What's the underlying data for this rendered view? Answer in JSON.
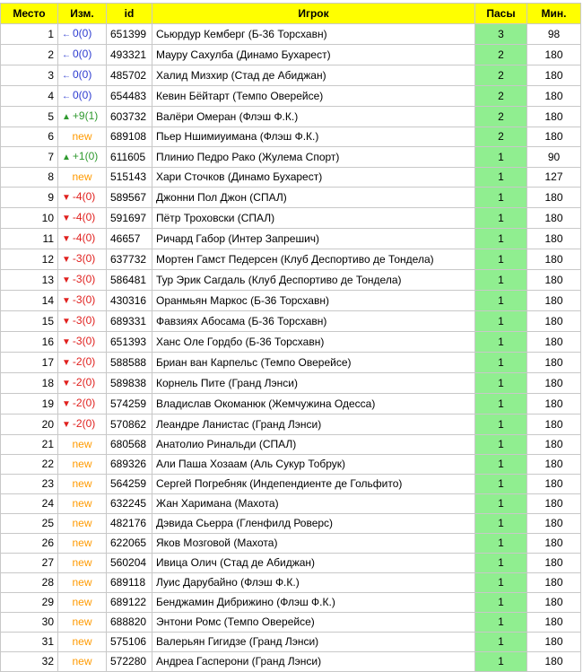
{
  "headers": {
    "place": "Место",
    "change": "Изм.",
    "id": "id",
    "player": "Игрок",
    "passes": "Пасы",
    "minutes": "Мин."
  },
  "colors": {
    "header_bg": "#ffff00",
    "passes_bg": "#90ee90",
    "flat": "#2c3bd0",
    "up": "#2f9a2f",
    "down": "#e0201e",
    "new": "#ff9a00"
  },
  "rows": [
    {
      "place": "1",
      "change_type": "flat",
      "change": "0(0)",
      "id": "651399",
      "player": "Сьюрдур Кемберг (Б-36 Торсхавн)",
      "passes": "3",
      "minutes": "98"
    },
    {
      "place": "2",
      "change_type": "flat",
      "change": "0(0)",
      "id": "493321",
      "player": "Мауру Сахулба (Динамо Бухарест)",
      "passes": "2",
      "minutes": "180"
    },
    {
      "place": "3",
      "change_type": "flat",
      "change": "0(0)",
      "id": "485702",
      "player": "Халид Мизхир (Стад де Абиджан)",
      "passes": "2",
      "minutes": "180"
    },
    {
      "place": "4",
      "change_type": "flat",
      "change": "0(0)",
      "id": "654483",
      "player": "Кевин Бёйтарт (Темпо Оверейсе)",
      "passes": "2",
      "minutes": "180"
    },
    {
      "place": "5",
      "change_type": "up",
      "change": "+9(1)",
      "id": "603732",
      "player": "Валёри Омеран (Флэш Ф.К.)",
      "passes": "2",
      "minutes": "180"
    },
    {
      "place": "6",
      "change_type": "new",
      "change": "new",
      "id": "689108",
      "player": "Пьер Ншимиyимана (Флэш Ф.К.)",
      "passes": "2",
      "minutes": "180"
    },
    {
      "place": "7",
      "change_type": "up",
      "change": "+1(0)",
      "id": "611605",
      "player": "Плинио Педро Рако (Жулема Спорт)",
      "passes": "1",
      "minutes": "90"
    },
    {
      "place": "8",
      "change_type": "new",
      "change": "new",
      "id": "515143",
      "player": "Хари Сточков (Динамо Бухарест)",
      "passes": "1",
      "minutes": "127"
    },
    {
      "place": "9",
      "change_type": "down",
      "change": "-4(0)",
      "id": "589567",
      "player": "Джонни Пол Джон (СПАЛ)",
      "passes": "1",
      "minutes": "180"
    },
    {
      "place": "10",
      "change_type": "down",
      "change": "-4(0)",
      "id": "591697",
      "player": "Пётр Троховски (СПАЛ)",
      "passes": "1",
      "minutes": "180"
    },
    {
      "place": "11",
      "change_type": "down",
      "change": "-4(0)",
      "id": "46657",
      "player": "Ричард Габор (Интер Запрешич)",
      "passes": "1",
      "minutes": "180"
    },
    {
      "place": "12",
      "change_type": "down",
      "change": "-3(0)",
      "id": "637732",
      "player": "Мортен Гамст Педерсен (Клуб Деспортиво де Тондела)",
      "passes": "1",
      "minutes": "180"
    },
    {
      "place": "13",
      "change_type": "down",
      "change": "-3(0)",
      "id": "586481",
      "player": "Тур Эрик Сагдаль (Клуб Деспортиво де Тондела)",
      "passes": "1",
      "minutes": "180"
    },
    {
      "place": "14",
      "change_type": "down",
      "change": "-3(0)",
      "id": "430316",
      "player": "Оранмьян Маркос (Б-36 Торсхавн)",
      "passes": "1",
      "minutes": "180"
    },
    {
      "place": "15",
      "change_type": "down",
      "change": "-3(0)",
      "id": "689331",
      "player": "Фавзиях Абосама (Б-36 Торсхавн)",
      "passes": "1",
      "minutes": "180"
    },
    {
      "place": "16",
      "change_type": "down",
      "change": "-3(0)",
      "id": "651393",
      "player": "Ханс Оле Гордбо (Б-36 Торсхавн)",
      "passes": "1",
      "minutes": "180"
    },
    {
      "place": "17",
      "change_type": "down",
      "change": "-2(0)",
      "id": "588588",
      "player": "Бриан ван Карпельс (Темпо Оверейсе)",
      "passes": "1",
      "minutes": "180"
    },
    {
      "place": "18",
      "change_type": "down",
      "change": "-2(0)",
      "id": "589838",
      "player": "Корнель Пите (Гранд Лэнси)",
      "passes": "1",
      "minutes": "180"
    },
    {
      "place": "19",
      "change_type": "down",
      "change": "-2(0)",
      "id": "574259",
      "player": "Владислав Окоманюк (Жемчужина Одесса)",
      "passes": "1",
      "minutes": "180"
    },
    {
      "place": "20",
      "change_type": "down",
      "change": "-2(0)",
      "id": "570862",
      "player": "Леандре Ланистас (Гранд Лэнси)",
      "passes": "1",
      "minutes": "180"
    },
    {
      "place": "21",
      "change_type": "new",
      "change": "new",
      "id": "680568",
      "player": "Анатолио Ринальди (СПАЛ)",
      "passes": "1",
      "minutes": "180"
    },
    {
      "place": "22",
      "change_type": "new",
      "change": "new",
      "id": "689326",
      "player": "Али Паша Хозаам (Аль Сукур Тобрук)",
      "passes": "1",
      "minutes": "180"
    },
    {
      "place": "23",
      "change_type": "new",
      "change": "new",
      "id": "564259",
      "player": "Сергей Погребняк (Индепендиенте де Гольфито)",
      "passes": "1",
      "minutes": "180"
    },
    {
      "place": "24",
      "change_type": "new",
      "change": "new",
      "id": "632245",
      "player": "Жан Харимана (Махота)",
      "passes": "1",
      "minutes": "180"
    },
    {
      "place": "25",
      "change_type": "new",
      "change": "new",
      "id": "482176",
      "player": "Дэвида Сьерра (Гленфилд Роверс)",
      "passes": "1",
      "minutes": "180"
    },
    {
      "place": "26",
      "change_type": "new",
      "change": "new",
      "id": "622065",
      "player": "Яков Мозговой (Махота)",
      "passes": "1",
      "minutes": "180"
    },
    {
      "place": "27",
      "change_type": "new",
      "change": "new",
      "id": "560204",
      "player": "Ивица Олич (Стад де Абиджан)",
      "passes": "1",
      "minutes": "180"
    },
    {
      "place": "28",
      "change_type": "new",
      "change": "new",
      "id": "689118",
      "player": "Луис Дарубайно (Флэш Ф.К.)",
      "passes": "1",
      "minutes": "180"
    },
    {
      "place": "29",
      "change_type": "new",
      "change": "new",
      "id": "689122",
      "player": "Бенджамин Дибрижино (Флэш Ф.К.)",
      "passes": "1",
      "minutes": "180"
    },
    {
      "place": "30",
      "change_type": "new",
      "change": "new",
      "id": "688820",
      "player": "Энтони Ромс (Темпо Оверейсе)",
      "passes": "1",
      "minutes": "180"
    },
    {
      "place": "31",
      "change_type": "new",
      "change": "new",
      "id": "575106",
      "player": "Валерьян Гигидзе (Гранд Лэнси)",
      "passes": "1",
      "minutes": "180"
    },
    {
      "place": "32",
      "change_type": "new",
      "change": "new",
      "id": "572280",
      "player": "Андреа Гаспeрони (Гранд Лэнси)",
      "passes": "1",
      "minutes": "180"
    }
  ]
}
